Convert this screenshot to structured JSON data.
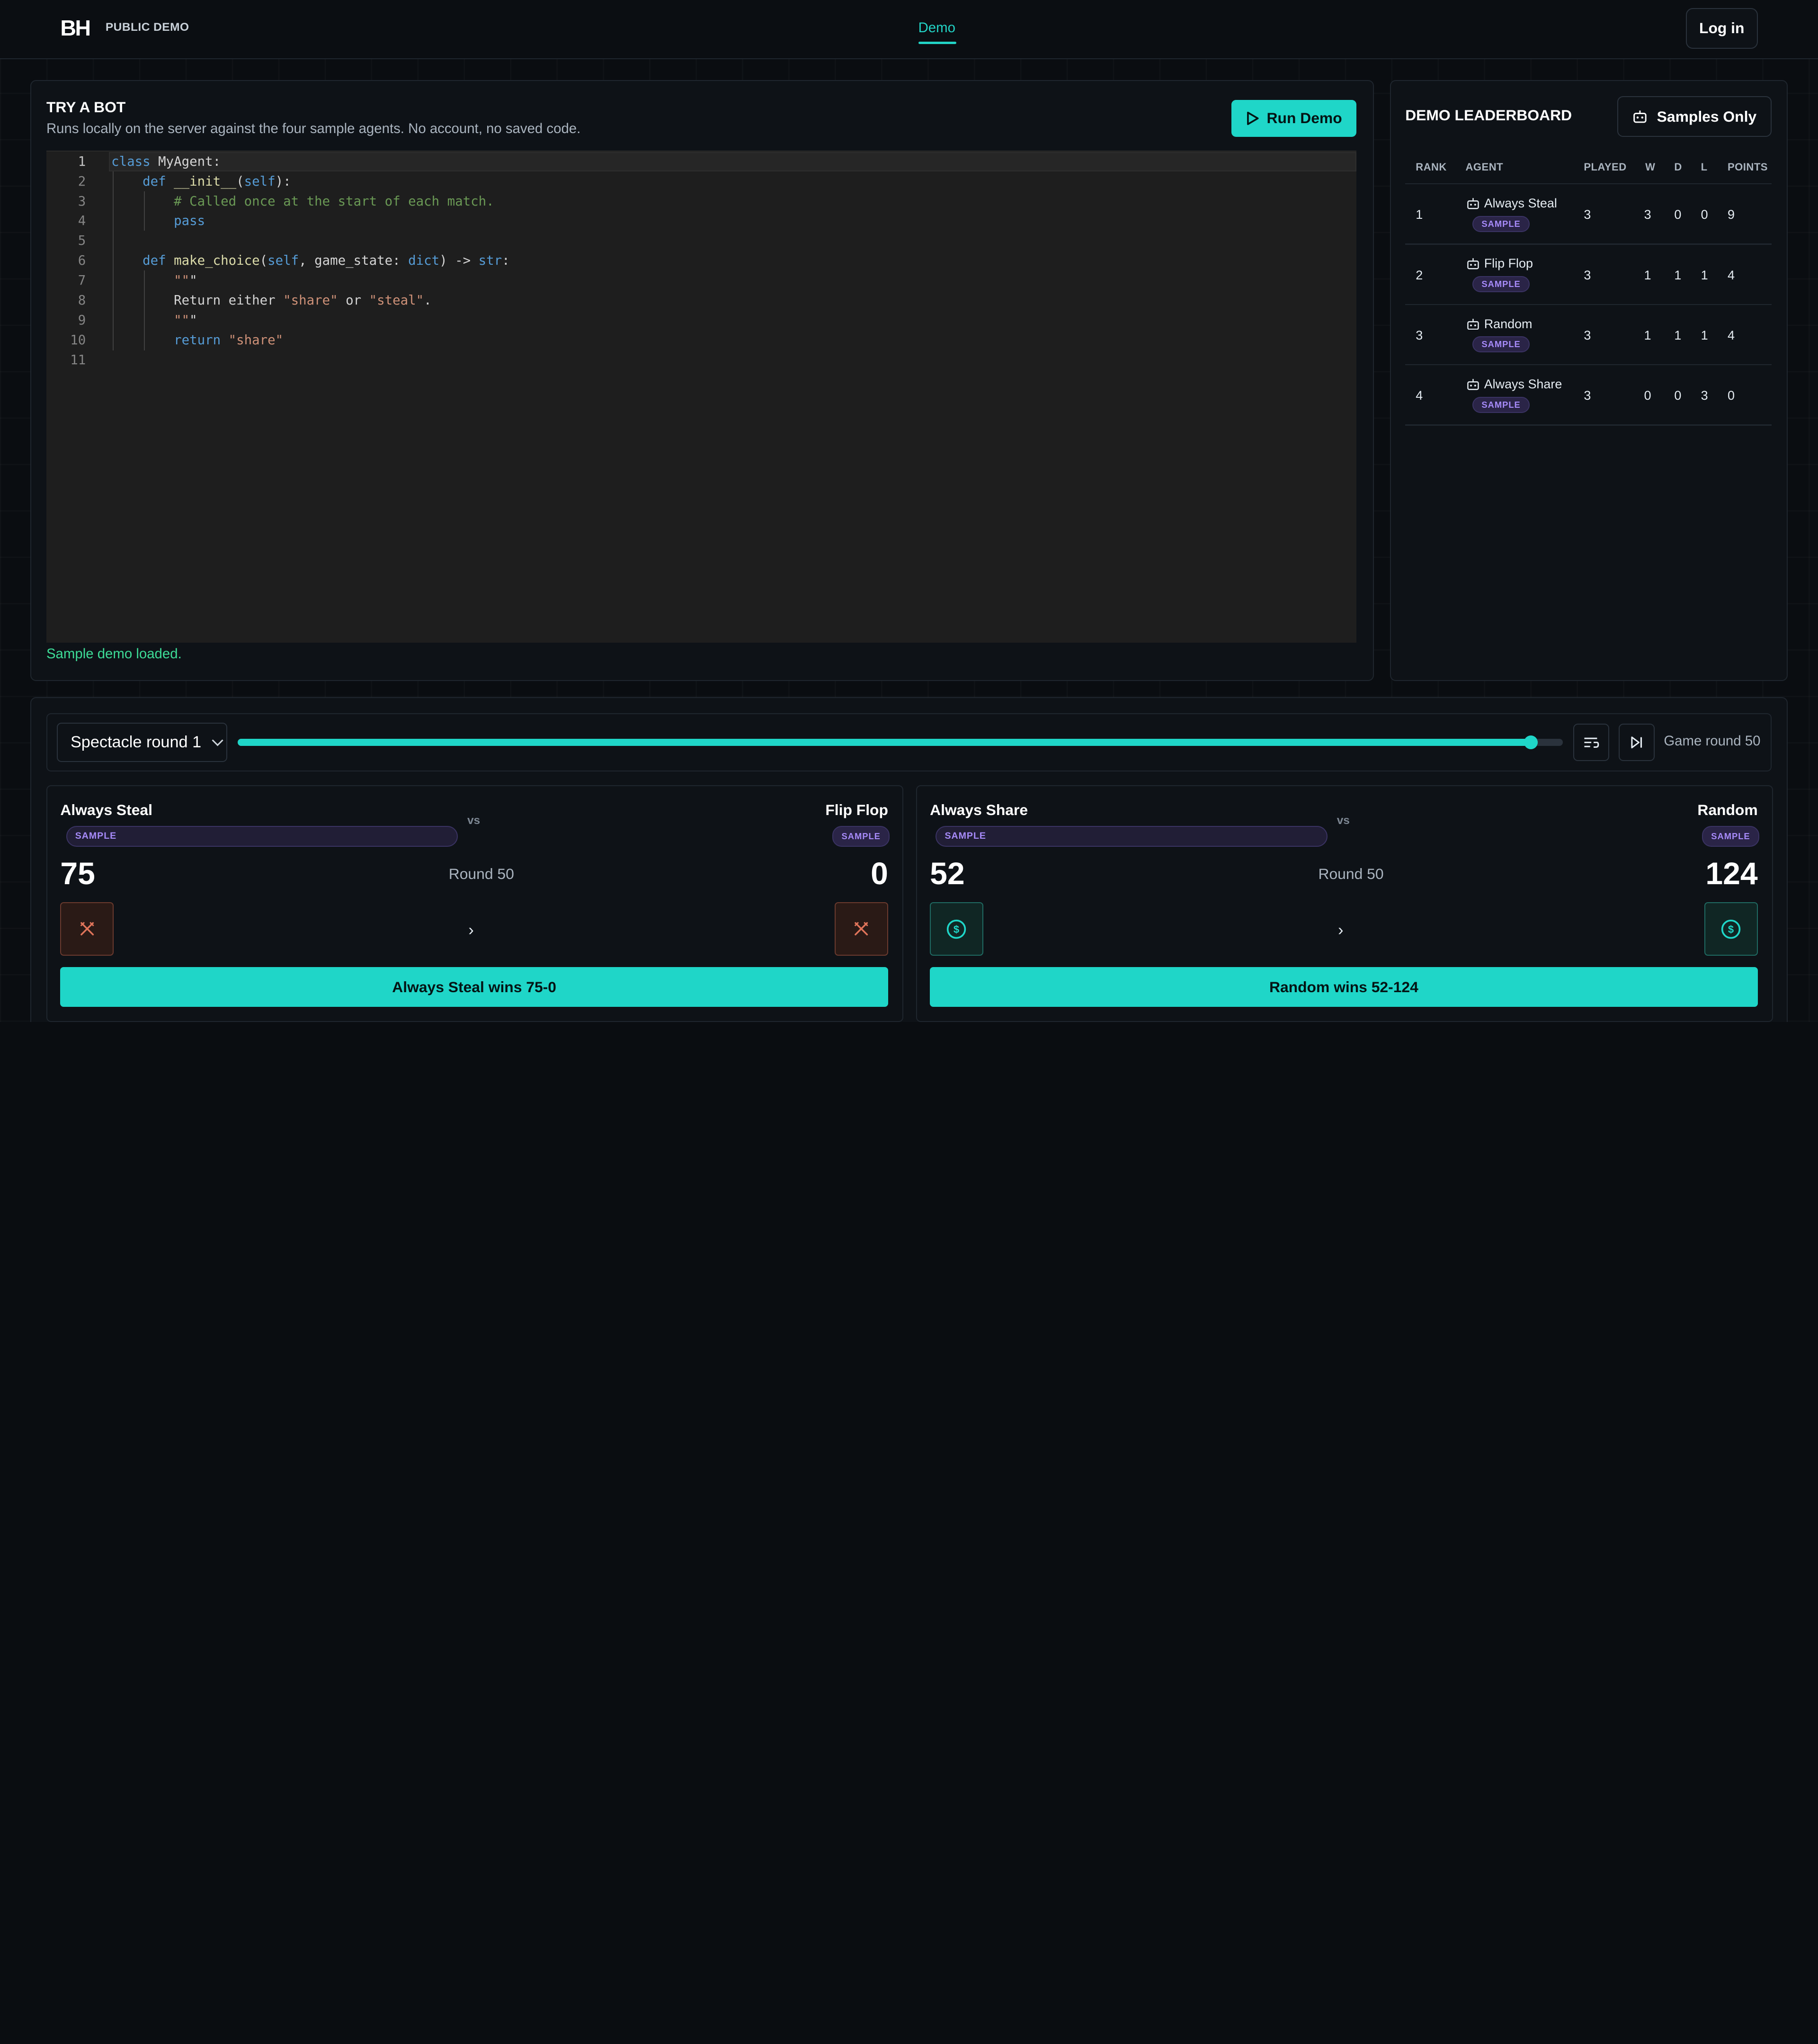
{
  "header": {
    "logo": "BH",
    "logo_sub": "PUBLIC DEMO",
    "nav_demo": "Demo",
    "login": "Log in"
  },
  "try_bot": {
    "title": "TRY A BOT",
    "subtitle": "Runs locally on the server against the four sample agents. No account, no saved code.",
    "run_button": "Run Demo",
    "status": "Sample demo loaded."
  },
  "editor": {
    "line_numbers": [
      "1",
      "2",
      "3",
      "4",
      "5",
      "6",
      "7",
      "8",
      "9",
      "10",
      "11"
    ],
    "current_line": 1,
    "code_lines": [
      "class MyAgent:",
      "    def __init__(self):",
      "        # Called once at the start of each match.",
      "        pass",
      "",
      "    def make_choice(self, game_state: dict) -> str:",
      "        \"\"\"",
      "        Return either \"share\" or \"steal\".",
      "        \"\"\"",
      "        return \"share\"",
      ""
    ]
  },
  "leaderboard": {
    "title": "DEMO LEADERBOARD",
    "filter_button": "Samples Only",
    "columns": [
      "RANK",
      "AGENT",
      "PLAYED",
      "W",
      "D",
      "L",
      "POINTS"
    ],
    "badge": "SAMPLE",
    "rows": [
      {
        "rank": "1",
        "agent": "Always Steal",
        "played": "3",
        "w": "3",
        "d": "0",
        "l": "0",
        "points": "9"
      },
      {
        "rank": "2",
        "agent": "Flip Flop",
        "played": "3",
        "w": "1",
        "d": "1",
        "l": "1",
        "points": "4"
      },
      {
        "rank": "3",
        "agent": "Random",
        "played": "3",
        "w": "1",
        "d": "1",
        "l": "1",
        "points": "4"
      },
      {
        "rank": "4",
        "agent": "Always Share",
        "played": "3",
        "w": "0",
        "d": "0",
        "l": "3",
        "points": "0"
      }
    ]
  },
  "controls": {
    "round_select": "Spectacle round 1",
    "game_round": "Game round 50",
    "progress": 0.988
  },
  "matches": [
    {
      "left_name": "Always Steal",
      "right_name": "Flip Flop",
      "vs": "vs",
      "badge": "SAMPLE",
      "left_score": "75",
      "right_score": "0",
      "round": "Round 50",
      "left_move": "steal",
      "right_move": "steal",
      "result": "Always Steal wins 75-0"
    },
    {
      "left_name": "Always Share",
      "right_name": "Random",
      "vs": "vs",
      "badge": "SAMPLE",
      "left_score": "52",
      "right_score": "124",
      "round": "Round 50",
      "left_move": "share",
      "right_move": "share",
      "result": "Random wins 52-124"
    }
  ],
  "colors": {
    "accent": "#1fd6c8",
    "badge": "#a78bfa",
    "status_ok": "#3ddc97",
    "steal": "#e0745a"
  },
  "icons": {
    "run": "play-icon",
    "samples": "robot-icon",
    "agent": "robot-icon",
    "queue": "list-icon",
    "skip": "skip-forward-icon",
    "steal": "crossed-swords-icon",
    "share": "coin-icon"
  }
}
